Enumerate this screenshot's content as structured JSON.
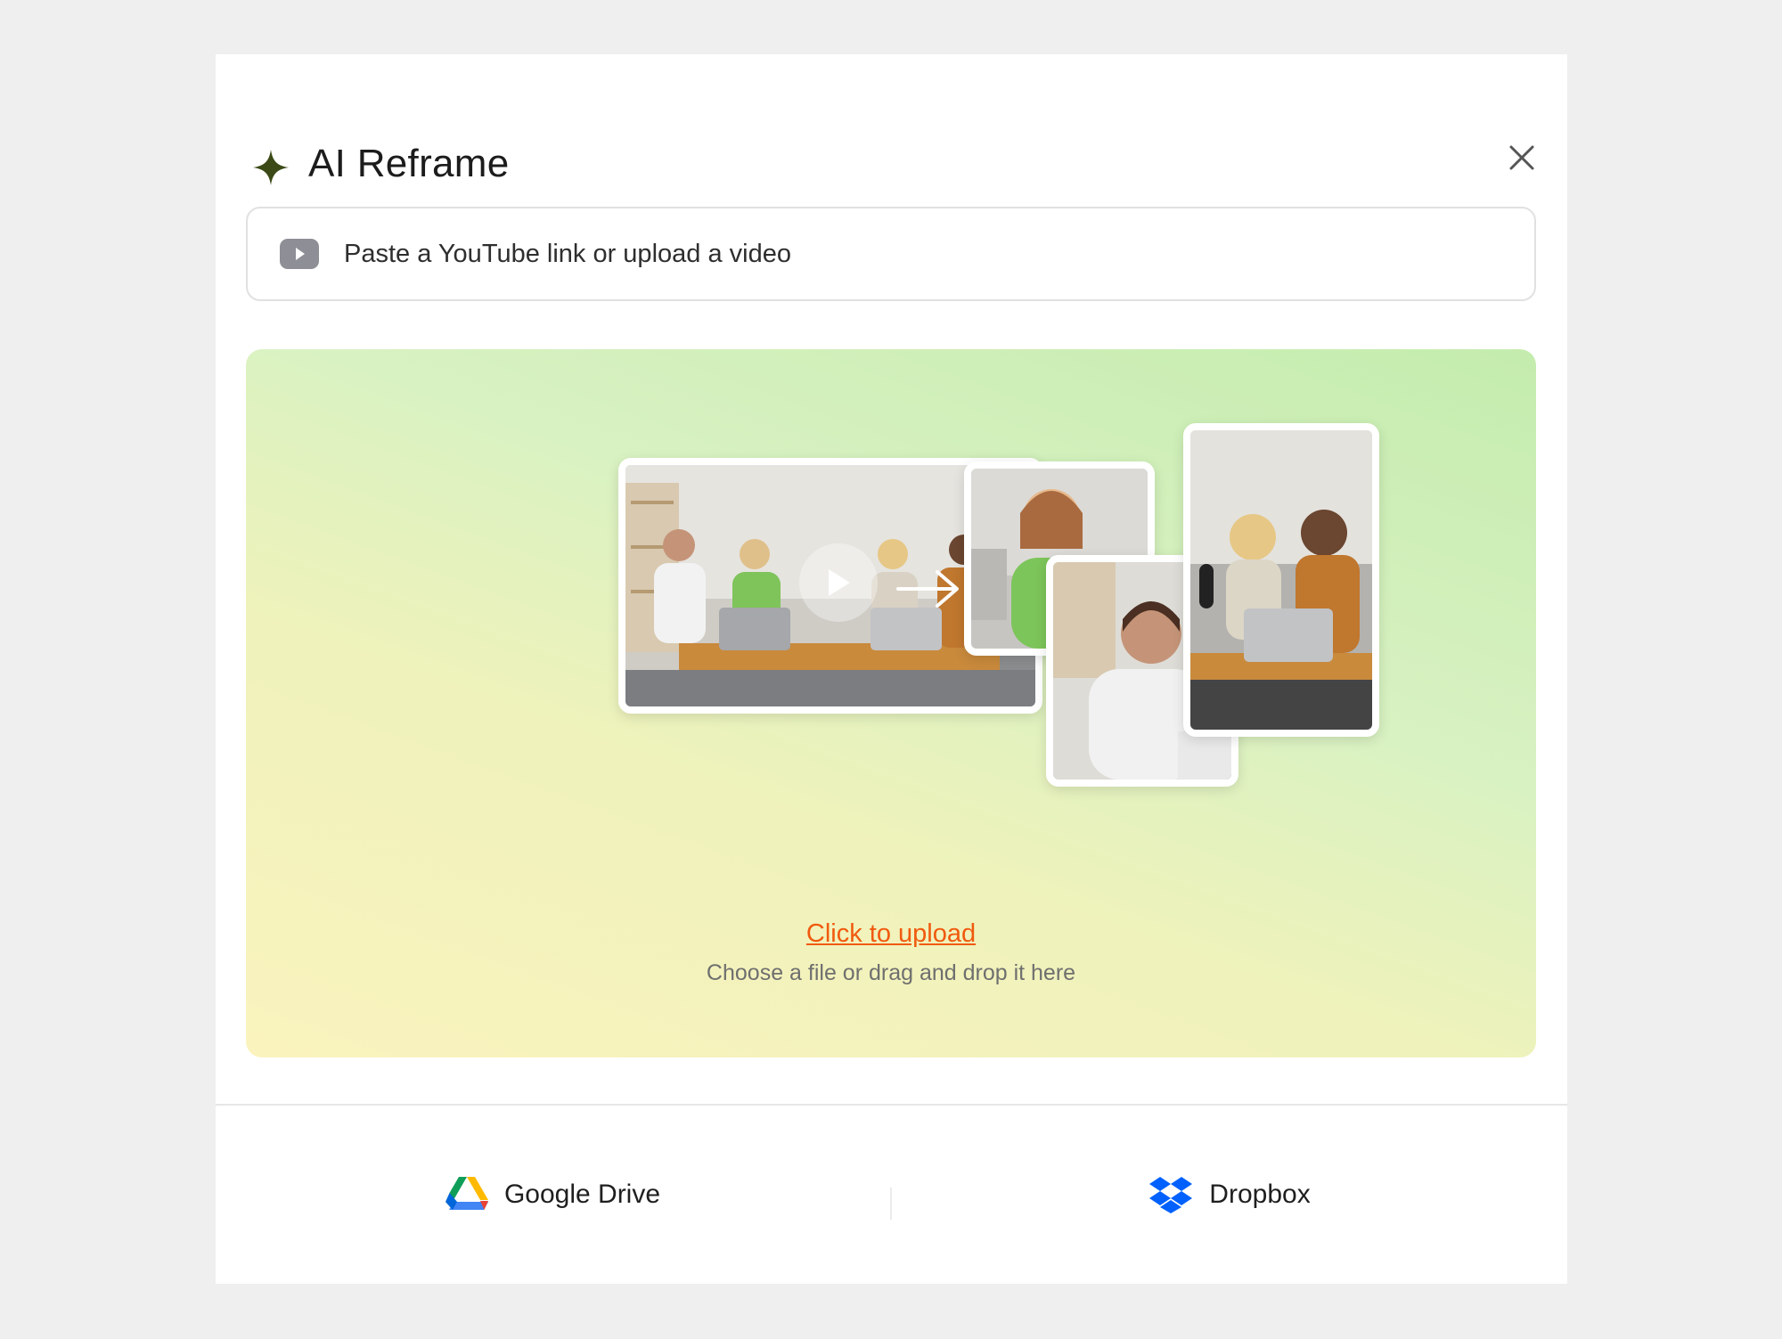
{
  "dialog": {
    "title": "AI Reframe",
    "close_icon": "close-icon",
    "title_icon": "sparkle-icon"
  },
  "link_input": {
    "placeholder": "Paste a YouTube link or upload a video",
    "icon": "youtube-icon"
  },
  "dropzone": {
    "upload_link": "Click to upload",
    "hint": "Choose a file or drag and drop it here",
    "illustration": "landscape-to-vertical-reframe"
  },
  "footer": {
    "google_drive_label": "Google Drive",
    "dropbox_label": "Dropbox"
  },
  "colors": {
    "accent_link": "#f05a0f",
    "sparkle": "#3b4a16",
    "dropbox_blue": "#0061fe"
  }
}
